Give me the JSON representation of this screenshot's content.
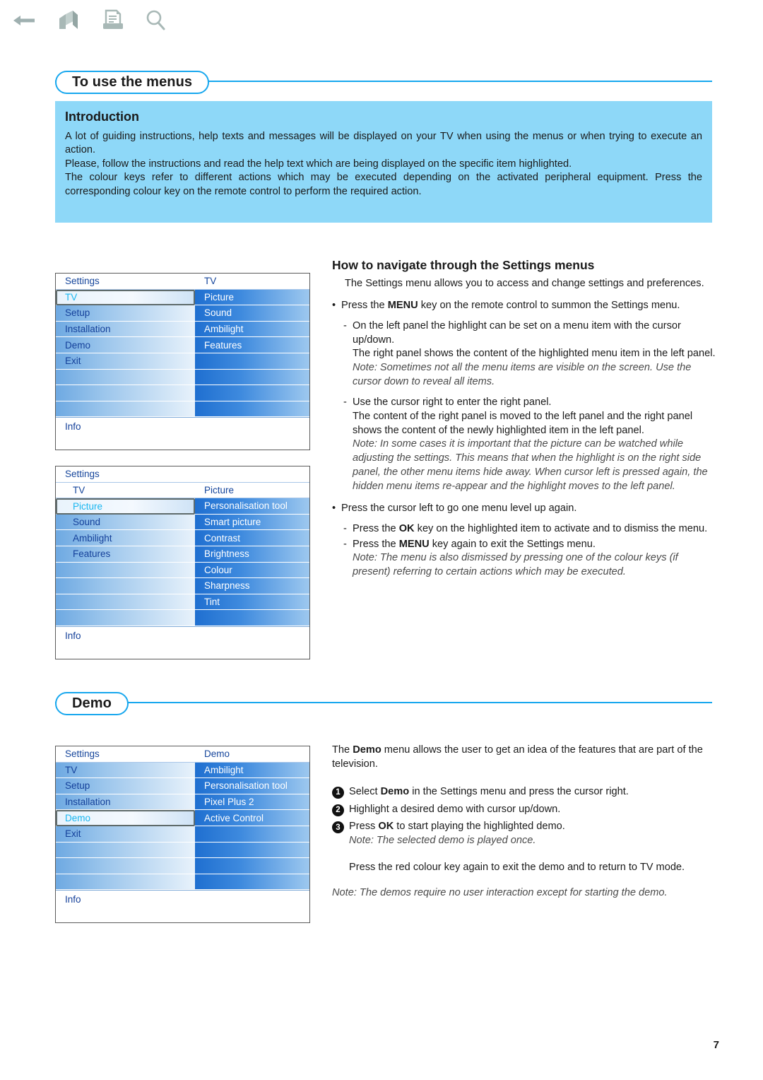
{
  "toolbar": {
    "icons": [
      {
        "name": "back-arrow-icon",
        "label": "Back"
      },
      {
        "name": "home-icon",
        "label": "Home"
      },
      {
        "name": "print-icon",
        "label": "Print"
      },
      {
        "name": "search-icon",
        "label": "Search"
      }
    ]
  },
  "colors": {
    "accent": "#17a7ee",
    "intro_background": "#8ed8f8",
    "menu_selected_text": "#18b6f0",
    "menu_label_text": "#14409a"
  },
  "sections": {
    "menus": {
      "title": "To use the menus",
      "intro": {
        "heading": "Introduction",
        "paragraphs": [
          "A lot of guiding instructions, help texts and messages will be displayed on your TV when using the menus or when trying to execute an action.",
          "Please, follow the instructions and read the help text which are being displayed on the specific item highlighted.",
          "The colour keys refer to different actions which may be executed depending on the activated peripheral equipment. Press the corresponding colour key on the remote control to perform the required action."
        ]
      },
      "navigate": {
        "heading": "How to navigate through the Settings menus",
        "lead": "The Settings menu allows you to access and change settings and preferences.",
        "b1": "Press the MENU key on the remote control to summon the Settings menu.",
        "b1_pre": "Press the ",
        "b1_key": "MENU",
        "b1_post": " key on the remote control to summon the Settings menu.",
        "d1": "On the left panel the highlight can be set on a menu item with the cursor up/down.",
        "d1b": "The right panel shows the content of the highlighted menu item in the left panel.",
        "d1_note": "Note: Sometimes not all the menu items are visible on the screen. Use the cursor down to reveal all items.",
        "d2": "Use the cursor right to enter the right panel.",
        "d2b": "The content of the right panel is moved to the left panel and the right panel shows the content of the newly highlighted item in the left panel.",
        "d2_note": "Note: In some cases it is important that the picture can be watched while adjusting the settings. This means that when the highlight is on the right side panel, the other menu items hide away. When cursor left is pressed again, the hidden menu items re-appear and the highlight moves to the left panel.",
        "b2": "Press the cursor left to go one menu level up again.",
        "d3_pre": "Press the ",
        "d3_key": "OK",
        "d3_post": " key on the highlighted item to activate and to dismiss the menu.",
        "d4_pre": "Press the ",
        "d4_key": "MENU",
        "d4_post": " key again to exit the Settings menu.",
        "d4_note": "Note: The menu is also dismissed by pressing one of the colour keys (if present) referring to certain actions which may be executed."
      }
    },
    "demo": {
      "title": "Demo",
      "lead_pre": "The ",
      "lead_key": "Demo",
      "lead_post": " menu allows the user to get an idea of the features that are part of the television.",
      "steps": [
        {
          "num": "1",
          "pre": "Select ",
          "key": "Demo",
          "post": " in the Settings menu and press the cursor right."
        },
        {
          "num": "2",
          "pre": "Highlight a desired demo with cursor up/down.",
          "key": "",
          "post": ""
        },
        {
          "num": "3",
          "pre": "Press ",
          "key": "OK",
          "post": " to start playing the highlighted demo."
        }
      ],
      "step_note": "Note: The selected demo is played once.",
      "closing": "Press the red colour key again to exit the demo and to return to TV mode.",
      "final_note": "Note: The demos require no user interaction except for starting the demo."
    }
  },
  "osd": {
    "info_label": "Info",
    "menu1": {
      "left_header": "Settings",
      "right_header": "TV",
      "left_items": [
        "TV",
        "Setup",
        "Installation",
        "Demo",
        "Exit"
      ],
      "left_selected": "TV",
      "right_items": [
        "Picture",
        "Sound",
        "Ambilight",
        "Features"
      ],
      "left_blank_rows": 3,
      "right_blank_rows": 4
    },
    "menu2": {
      "top_header": "Settings",
      "sub_left_header": "TV",
      "sub_right_header": "Picture",
      "left_items": [
        "Picture",
        "Sound",
        "Ambilight",
        "Features"
      ],
      "left_selected": "Picture",
      "right_items": [
        "Personalisation tool",
        "Smart picture",
        "Contrast",
        "Brightness",
        "Colour",
        "Sharpness",
        "Tint"
      ],
      "left_blank_rows": 4,
      "right_blank_rows": 1
    },
    "menu3": {
      "left_header": "Settings",
      "right_header": "Demo",
      "left_items": [
        "TV",
        "Setup",
        "Installation",
        "Demo",
        "Exit"
      ],
      "left_selected": "Demo",
      "right_items": [
        "Ambilight",
        "Personalisation tool",
        "Pixel Plus 2",
        "Active Control"
      ],
      "left_blank_rows": 3,
      "right_blank_rows": 4
    }
  },
  "page": {
    "number": "7"
  }
}
